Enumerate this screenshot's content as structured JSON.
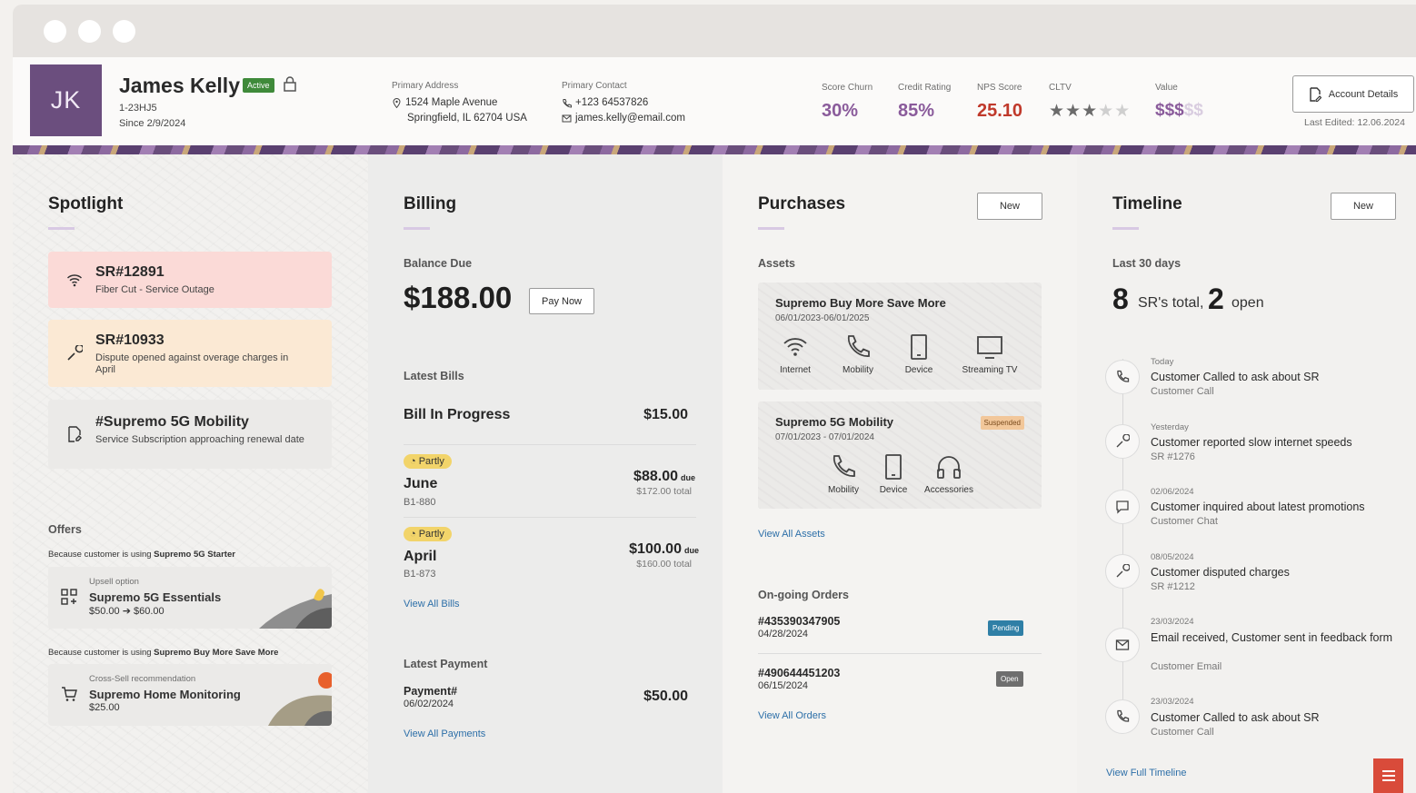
{
  "header": {
    "initials": "JK",
    "name": "James Kelly",
    "status": "Active",
    "account_id": "1-23HJ5",
    "since": "Since 2/9/2024",
    "address_label": "Primary Address",
    "address_line1": "1524 Maple Avenue",
    "address_line2": "Springfield, IL 62704 USA",
    "contact_label": "Primary Contact",
    "phone": "+123 64537826",
    "email": "james.kelly@email.com",
    "metrics": [
      {
        "label": "Score Churn",
        "value": "30%",
        "color": "#8a5b9b"
      },
      {
        "label": "Credit Rating",
        "value": "85%",
        "color": "#8a5b9b"
      },
      {
        "label": "NPS Score",
        "value": "25.10",
        "color": "#c0392b"
      }
    ],
    "cltv_label": "CLTV",
    "cltv_stars": 3,
    "cltv_max": 5,
    "value_label": "Value",
    "value_on": "$$$",
    "value_off": "$$",
    "account_button": "Account Details",
    "last_edited": "Last Edited: 12.06.2024"
  },
  "spotlight": {
    "title": "Spotlight",
    "cards": [
      {
        "title": "SR#12891",
        "desc": "Fiber Cut - Service Outage",
        "icon": "wifi-icon",
        "bg": "#fbdad7"
      },
      {
        "title": "SR#10933",
        "desc": "Dispute opened against overage charges in April",
        "icon": "wrench-icon",
        "bg": "#fbe9d4"
      },
      {
        "title": "#Supremo 5G Mobility",
        "desc": "Service Subscription approaching renewal date",
        "icon": "document-icon",
        "bg": "#ebeae8"
      }
    ],
    "offers_label": "Offers",
    "offers": [
      {
        "caption_prefix": "Because customer is using",
        "caption_product": "Supremo 5G Starter",
        "small": "Upsell option",
        "title": "Supremo 5G Essentials",
        "price_from": "$50.00",
        "price_to": "$60.00",
        "icon": "upgrade-icon"
      },
      {
        "caption_prefix": "Because customer is using",
        "caption_product": "Supremo Buy More Save More",
        "small": "Cross-Sell recommendation",
        "title": "Supremo Home Monitoring",
        "price": "$25.00",
        "icon": "cart-icon"
      }
    ]
  },
  "billing": {
    "title": "Billing",
    "balance_label": "Balance Due",
    "balance": "$188.00",
    "pay_button": "Pay Now",
    "latest_bills_label": "Latest Bills",
    "in_progress_label": "Bill In Progress",
    "in_progress_amount": "$15.00",
    "bills": [
      {
        "badge": "Partly",
        "month": "June",
        "code": "B1-880",
        "due": "$88.00",
        "due_word": "due",
        "total": "$172.00 total"
      },
      {
        "badge": "Partly",
        "month": "April",
        "code": "B1-873",
        "due": "$100.00",
        "due_word": "due",
        "total": "$160.00 total"
      }
    ],
    "view_all_bills": "View All Bills",
    "latest_payment_label": "Latest Payment",
    "payment_title": "Payment#",
    "payment_date": "06/02/2024",
    "payment_amount": "$50.00",
    "view_all_payments": "View All Payments"
  },
  "purchases": {
    "title": "Purchases",
    "new_button": "New",
    "assets_label": "Assets",
    "assets": [
      {
        "title": "Supremo Buy More Save More",
        "dates": "06/01/2023-06/01/2025",
        "items": [
          "Internet",
          "Mobility",
          "Device",
          "Streaming TV"
        ]
      },
      {
        "title": "Supremo 5G Mobility",
        "dates": "07/01/2023 - 07/01/2024",
        "status": "Suspended",
        "items": [
          "Mobility",
          "Device",
          "Accessories"
        ]
      }
    ],
    "view_all_assets": "View All Assets",
    "orders_label": "On-going Orders",
    "orders": [
      {
        "id": "#435390347905",
        "date": "04/28/2024",
        "status": "Pending",
        "color": "#2f7fa6"
      },
      {
        "id": "#490644451203",
        "date": "06/15/2024",
        "status": "Open",
        "color": "#6e6e6e"
      }
    ],
    "view_all_orders": "View All Orders"
  },
  "timeline": {
    "title": "Timeline",
    "new_button": "New",
    "period_label": "Last 30 days",
    "total": "8",
    "total_text": "SR's total,",
    "open": "2",
    "open_text": "open",
    "events": [
      {
        "date": "Today",
        "title": "Customer Called to ask about SR",
        "sub": "Customer Call",
        "icon": "phone-icon"
      },
      {
        "date": "Yesterday",
        "title": "Customer reported slow internet speeds",
        "sub": "SR #1276",
        "icon": "wrench-icon"
      },
      {
        "date": "02/06/2024",
        "title": "Customer inquired about latest promotions",
        "sub": "Customer Chat",
        "icon": "chat-icon"
      },
      {
        "date": "08/05/2024",
        "title": "Customer disputed charges",
        "sub": "SR #1212",
        "icon": "wrench-icon"
      },
      {
        "date": "23/03/2024",
        "title": "Email received, Customer sent in feedback form",
        "sub": "Customer Email",
        "icon": "mail-icon"
      },
      {
        "date": "23/03/2024",
        "title": "Customer Called to ask about SR",
        "sub": "Customer Call",
        "icon": "phone-icon"
      }
    ],
    "view_full": "View Full Timeline"
  }
}
